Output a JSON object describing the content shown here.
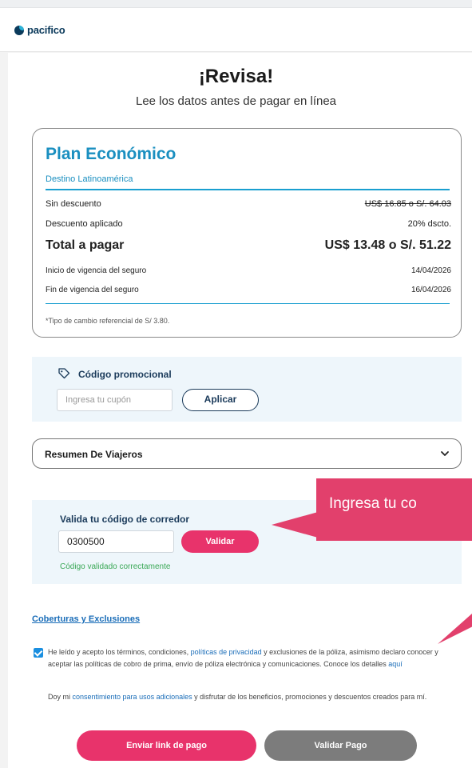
{
  "brand": {
    "name": "pacifico"
  },
  "page": {
    "title": "¡Revisa!",
    "subtitle": "Lee los datos antes de pagar en línea"
  },
  "plan": {
    "name": "Plan Económico",
    "destination": "Destino Latinoamérica",
    "rows": {
      "no_discount_label": "Sin descuento",
      "no_discount_value": "US$ 16.85 o S/. 64.03",
      "discount_label": "Descuento aplicado",
      "discount_value": "20% dscto.",
      "total_label": "Total a pagar",
      "total_value": "US$ 13.48 o S/. 51.22",
      "start_label": "Inicio de vigencia del seguro",
      "start_value": "14/04/2026",
      "end_label": "Fin de vigencia del seguro",
      "end_value": "16/04/2026"
    },
    "footnote": "*Tipo de cambio referencial de S/ 3.80."
  },
  "promo": {
    "label": "Código promocional",
    "placeholder": "Ingresa tu cupón",
    "button": "Aplicar"
  },
  "travelers": {
    "label": "Resumen De Viajeros"
  },
  "broker": {
    "label": "Valida tu código de corredor",
    "value": "0300500",
    "button": "Validar",
    "status": "Código validado correctamente"
  },
  "tooltip": {
    "text": "Ingresa tu co"
  },
  "coverage": {
    "link": "Coberturas y Exclusiones"
  },
  "legal": {
    "p1_a": "He leído y acepto los términos, condiciones, ",
    "p1_link": "políticas de privacidad",
    "p1_b": " y exclusiones de la póliza, asimismo declaro conocer y aceptar las políticas de cobro de prima, envío de póliza electrónica y comunicaciones. Conoce los detalles ",
    "p1_here": "aquí",
    "p2_a": "Doy mi ",
    "p2_link": "consentimiento para usos adicionales",
    "p2_b": " y disfrutar de los beneficios, promociones y descuentos creados para mí."
  },
  "actions": {
    "send_link": "Enviar link de pago",
    "validate_payment": "Validar Pago"
  },
  "colors": {
    "primary_blue": "#1a8fc0",
    "accent_pink": "#e8336b",
    "success_green": "#3aa856",
    "gray_button": "#7c7c7c"
  }
}
